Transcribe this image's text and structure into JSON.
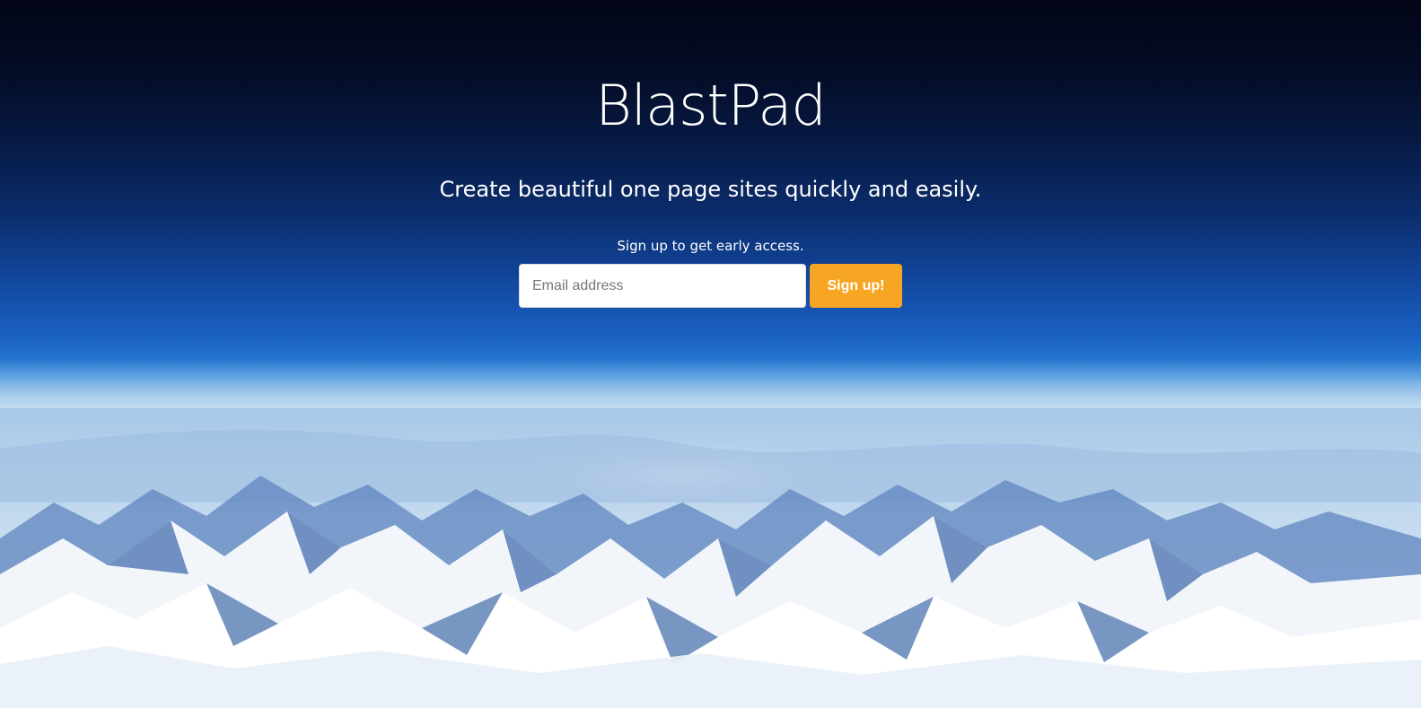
{
  "hero": {
    "brand": "BlastPad",
    "tagline": "Create beautiful one page sites quickly and easily.",
    "signup_note": "Sign up to get early access."
  },
  "signup_form": {
    "email_placeholder": "Email address",
    "email_value": "",
    "button_label": "Sign up!"
  },
  "colors": {
    "button_accent": "#f6a623",
    "sky_top": "#020616",
    "sky_mid": "#1b63c4",
    "snow": "#e8f0f8"
  }
}
